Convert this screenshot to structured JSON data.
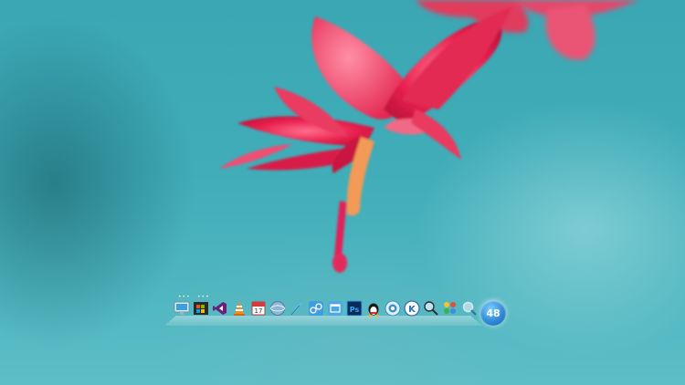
{
  "desktop": {
    "wallpaper": "red-flower-on-teal",
    "colors": {
      "background": "#40adb8",
      "flower": "#e8214f",
      "flower_highlight": "#ff5b7a",
      "stamen": "#f4a15a"
    }
  },
  "dock": {
    "icons": [
      {
        "name": "monitor-icon",
        "running": true
      },
      {
        "name": "windows-flag-icon",
        "running": true
      },
      {
        "name": "visual-studio-icon",
        "running": false
      },
      {
        "name": "vlc-cone-icon",
        "running": false
      },
      {
        "name": "calendar-icon",
        "running": false
      },
      {
        "name": "globe-icon",
        "running": false
      },
      {
        "name": "feather-icon",
        "running": false
      },
      {
        "name": "network-icon",
        "running": false
      },
      {
        "name": "window-icon",
        "running": false
      },
      {
        "name": "photoshop-icon",
        "label": "Ps",
        "running": false
      },
      {
        "name": "qq-penguin-icon",
        "running": false
      },
      {
        "name": "browser-icon",
        "running": false
      },
      {
        "name": "k-app-icon",
        "label": "K",
        "running": false
      },
      {
        "name": "search-magnifier-icon",
        "running": false
      },
      {
        "name": "colorful-app-icon",
        "running": false
      },
      {
        "name": "search-icon",
        "running": false
      }
    ],
    "running_indicator": "•••"
  },
  "start_orb": {
    "label": "48"
  }
}
